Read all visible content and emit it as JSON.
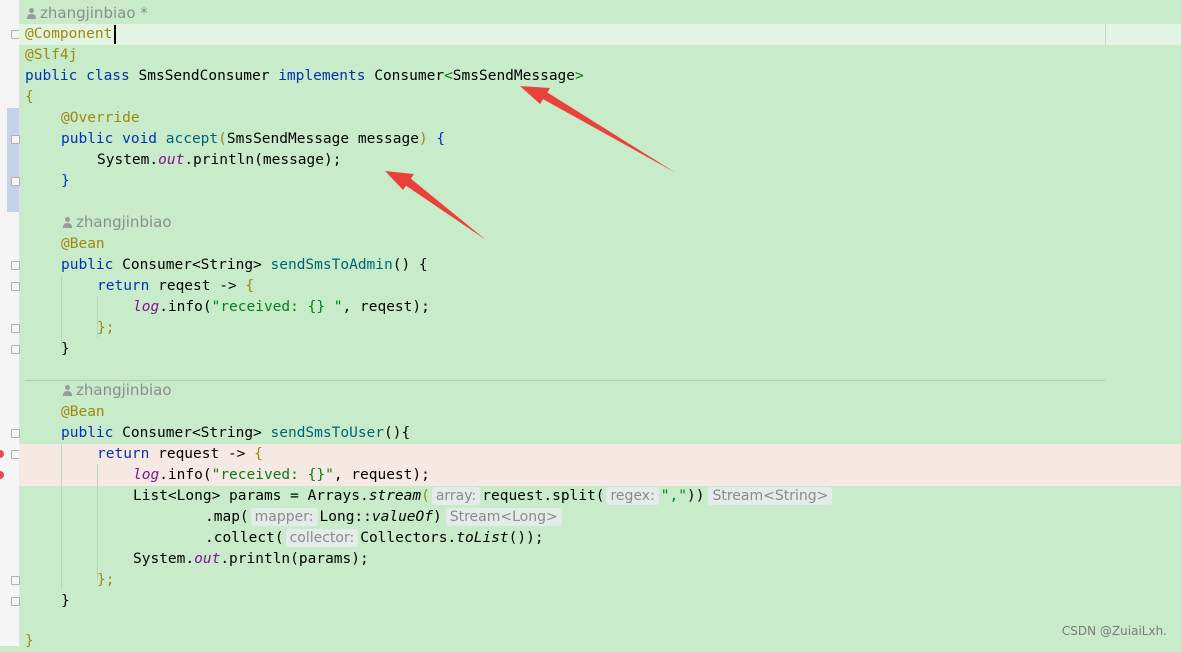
{
  "editor": {
    "author_modified": "zhangjinbiao *",
    "author": "zhangjinbiao",
    "lines": {
      "l1": "@Component",
      "l2": "@Slf4j",
      "l3_kw1": "public class ",
      "l3_cls": "SmsSendConsumer ",
      "l3_kw2": "implements ",
      "l3_iface": "Consumer",
      "l3_lt": "<",
      "l3_gen": "SmsSendMessage",
      "l3_gt": ">",
      "l4": "{",
      "l5": "@Override",
      "l6_kw": "public void ",
      "l6_fn": "accept",
      "l6_po": "(",
      "l6_args": "SmsSendMessage message",
      "l6_pc": ")",
      "l6_b": " {",
      "l7_a": "System.",
      "l7_out": "out",
      "l7_b": ".println(message);",
      "l8": "}",
      "l9_ann": "@Bean",
      "l10_kw": "public ",
      "l10_type": "Consumer<String> ",
      "l10_fn": "sendSmsToAdmin",
      "l10_rest": "() {",
      "l11_kw": "return ",
      "l11_rest": "reqest -> ",
      "l11_b": "{",
      "l12_log": "log",
      "l12_a": ".info(",
      "l12_str": "\"received: {} \"",
      "l12_b": ", reqest);",
      "l13": "};",
      "l14": "}",
      "l15_ann": "@Bean",
      "l16_kw": "public ",
      "l16_type": "Consumer<String> ",
      "l16_fn": "sendSmsToUser",
      "l16_rest": "(){",
      "l17_kw": "return ",
      "l17_rest": "request -> ",
      "l17_b": "{",
      "l18_log": "log",
      "l18_a": ".info(",
      "l18_str": "\"received: {}\"",
      "l18_b": ", request);",
      "l19_a": "List<Long> params = Arrays.",
      "l19_stream": "stream",
      "l19_po": "(",
      "l19_hint1": "array:",
      "l19_b": "request.split(",
      "l19_hint2": "regex:",
      "l19_str": "\",\"",
      "l19_c": "))",
      "l19_type": "Stream<String>",
      "l20_a": ".map(",
      "l20_hint": "mapper:",
      "l20_b": "Long::",
      "l20_valueof": "valueOf",
      "l20_c": ")",
      "l20_type": "Stream<Long>",
      "l21_a": ".collect(",
      "l21_hint": "collector:",
      "l21_b": "Collectors.",
      "l21_tolist": "toList",
      "l21_c": "());",
      "l22_a": "System.",
      "l22_out": "out",
      "l22_b": ".println(params);",
      "l23": "};",
      "l24": "}",
      "l25": "}"
    }
  },
  "watermark": "CSDN @ZuiaiLxh.",
  "colors": {
    "background": "#c8ecca",
    "error_band": "#f6e8e3",
    "arrow": "#e8423a"
  }
}
